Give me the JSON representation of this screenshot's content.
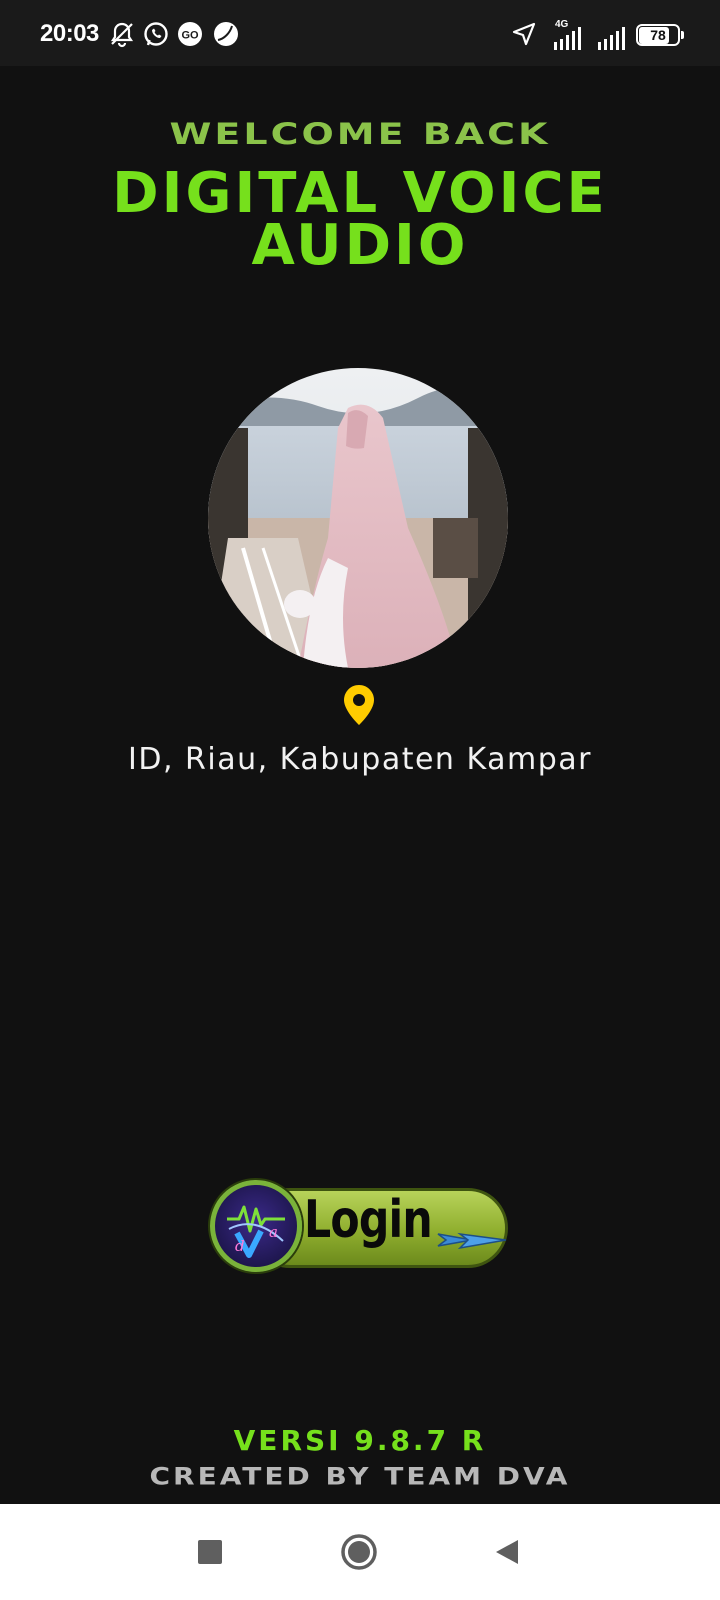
{
  "status_bar": {
    "time": "20:03",
    "icons": [
      "notifications-off-icon",
      "whatsapp-icon",
      "gojek-icon",
      "moon-app-icon",
      "location-arrow-icon",
      "signal-4g-icon",
      "signal-icon",
      "battery-icon"
    ],
    "network_label": "4G",
    "battery_level": "78",
    "battery_fraction": 0.78
  },
  "header": {
    "welcome": "WELCOME BACK",
    "title_line1": "DIGITAL VOICE",
    "title_line2": "AUDIO"
  },
  "profile": {
    "avatar_icon": "profile-photo",
    "location_icon": "map-pin-icon",
    "location": "ID, Riau, Kabupaten Kampar"
  },
  "login": {
    "label": "Login",
    "logo_icon": "dva-logo-icon",
    "arrow_icon": "arrow-right-icon"
  },
  "footer": {
    "version": "VERSI 9.8.7  R",
    "credits": "CREATED BY TEAM DVA"
  },
  "nav_bar": {
    "buttons": [
      "recents-square-icon",
      "home-circle-icon",
      "back-triangle-icon"
    ]
  },
  "colors": {
    "background": "#111111",
    "accent_green": "#76e01c",
    "welcome_green": "#8bc34a",
    "pin_yellow": "#ffcc00",
    "credits_gray": "#b8b8b8"
  }
}
